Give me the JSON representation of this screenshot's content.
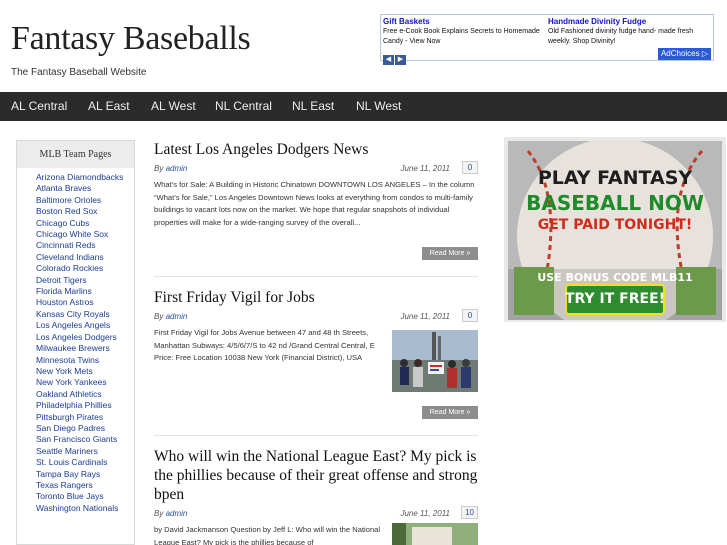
{
  "site": {
    "title": "Fantasy Baseballs",
    "tagline": "The Fantasy Baseball Website"
  },
  "ad": {
    "items": [
      {
        "title": "Gift Baskets",
        "text": "Free e-Cook Book Explains Secrets to Homemade Candy - View Now"
      },
      {
        "title": "Handmade Divinity Fudge",
        "text": "Old Fashioned divinity fudge hand- made fresh weekly. Shop Divinity!"
      }
    ],
    "prev_icon": "chevron-left-icon",
    "next_icon": "chevron-right-icon",
    "prev_glyph": "◀",
    "next_glyph": "▶",
    "adchoices_label": "AdChoices ▷"
  },
  "nav": {
    "items": [
      "AL Central",
      "AL East",
      "AL West",
      "NL Central",
      "NL East",
      "NL West"
    ]
  },
  "sidebar": {
    "title": "MLB Team Pages",
    "teams": [
      "Arizona Diamondbacks",
      "Atlanta Braves",
      "Baltimore Orioles",
      "Boston Red Sox",
      "Chicago Cubs",
      "Chicago White Sox",
      "Cincinnati Reds",
      "Cleveland Indians",
      "Colorado Rockies",
      "Detroit Tigers",
      "Florida Marlins",
      "Houston Astros",
      "Kansas City Royals",
      "Los Angeles Angels",
      "Los Angeles Dodgers",
      "Milwaukee Brewers",
      "Minnesota Twins",
      "New York Mets",
      "New York Yankees",
      "Oakland Athletics",
      "Philadelphia Phillies",
      "Pittsburgh Pirates",
      "San Diego Padres",
      "San Francisco Giants",
      "Seattle Mariners",
      "St. Louis Cardinals",
      "Tampa Bay Rays",
      "Texas Rangers",
      "Toronto Blue Jays",
      "Washington Nationals"
    ]
  },
  "posts": [
    {
      "title": "Latest Los Angeles Dodgers News",
      "by": "By",
      "author": "admin",
      "date": "June 11, 2011",
      "comments": "0",
      "excerpt": "What’s for Sale: A Building in Historic Chinatown DOWNTOWN LOS ANGELES – In the column “What’s for Sale,” Los Angeles Downtown News looks at everything from condos to multi-family buildings to vacant lots now on the market. We hope that regular snapshots of individual properties will make for a wide-ranging survey of the overall...",
      "read_more": "Read More »"
    },
    {
      "title": "First Friday Vigil for Jobs",
      "by": "By",
      "author": "admin",
      "date": "June 11, 2011",
      "comments": "0",
      "excerpt": "First Friday Vigil for Jobs Avenue between 47 and 48 th Streets, Manhattan Subways: 4/5/6/7/S to 42 nd /Grand Central Central, E Price: Free Location 10038 New York (Financial District), USA",
      "read_more": "Read More »"
    },
    {
      "title": "Who will win the National League East? My pick is the phillies because of their great offense and strong bpen",
      "by": "By",
      "author": "admin",
      "date": "June 11, 2011",
      "comments": "10",
      "excerpt": "by David Jackmanson Question by Jeff L: Who will win the National League East? My pick is the phillies because of"
    }
  ],
  "banner": {
    "line1": "PLAY FANTASY",
    "line2": "BASEBALL NOW",
    "line3": "GET PAID TONIGHT!",
    "line4": "USE BONUS CODE MLB11",
    "line5": "TRY IT FREE!"
  },
  "colors": {
    "nav_bg": "#2b2b2b",
    "link": "#1d3c91",
    "banner_green": "#1f8a2a",
    "banner_yellow": "#f2e21a"
  }
}
